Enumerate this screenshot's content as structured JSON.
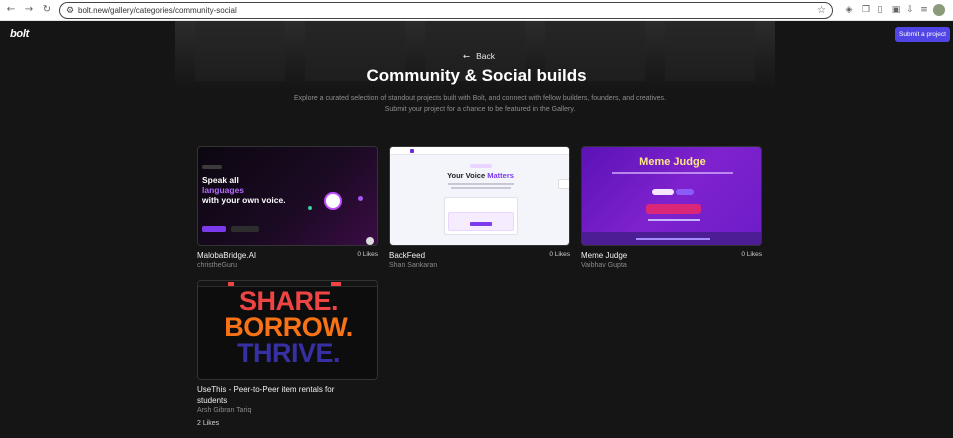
{
  "browser": {
    "url": "bolt.new/gallery/categories/community-social"
  },
  "header": {
    "logo": "bolt",
    "submit_label": "Submit a project"
  },
  "hero": {
    "back_label": "Back",
    "title": "Community & Social builds",
    "description": "Explore a curated selection of standout projects built with Bolt, and connect with fellow builders, founders, and creatives. Submit your project for a chance to be featured in the Gallery."
  },
  "cards": [
    {
      "name": "MalobaBridge.AI",
      "author": "christheGuru",
      "likes": "0 Likes",
      "thumb": {
        "line1": "Speak all",
        "line2": "languages",
        "line3": "with your own voice."
      }
    },
    {
      "name": "BackFeed",
      "author": "Shan Sankaran",
      "likes": "0 Likes",
      "thumb": {
        "headline": "Your Voice",
        "headline_accent": "Matters"
      }
    },
    {
      "name": "Meme Judge",
      "author": "Vaibhav Gupta",
      "likes": "0 Likes",
      "thumb": {
        "headline": "Meme Judge"
      }
    },
    {
      "name": "UseThis - Peer-to-Peer item rentals for students",
      "author": "Arsh Gibran Tariq",
      "likes": "2 Likes",
      "thumb": {
        "word1": "SHARE.",
        "word2": "BORROW.",
        "word3": "THRIVE."
      }
    }
  ],
  "colors": {
    "accent": "#4f46e5",
    "share": "#ef4444",
    "borrow": "#f97316",
    "thrive": "#3730a3"
  }
}
